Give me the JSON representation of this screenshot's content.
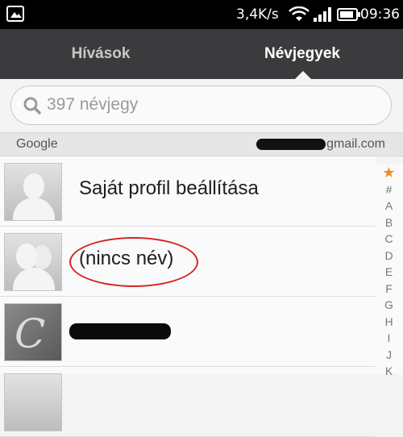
{
  "status_bar": {
    "network_speed": "3,4K/s",
    "time": "09:36"
  },
  "tabs": [
    {
      "label": "Hívások",
      "active": false
    },
    {
      "label": "Névjegyek",
      "active": true
    }
  ],
  "search": {
    "placeholder": "397 névjegy"
  },
  "account": {
    "provider": "Google",
    "email_suffix": "gmail.com"
  },
  "contacts": [
    {
      "name": "Saját profil beállítása"
    },
    {
      "name": "(nincs név)"
    }
  ],
  "index": [
    "★",
    "#",
    "A",
    "B",
    "C",
    "D",
    "E",
    "F",
    "G",
    "H",
    "I",
    "J",
    "K"
  ],
  "colors": {
    "accent_star": "#f08a24",
    "tab_bar": "#3b3b3e",
    "annotation_circle": "#d42424"
  }
}
